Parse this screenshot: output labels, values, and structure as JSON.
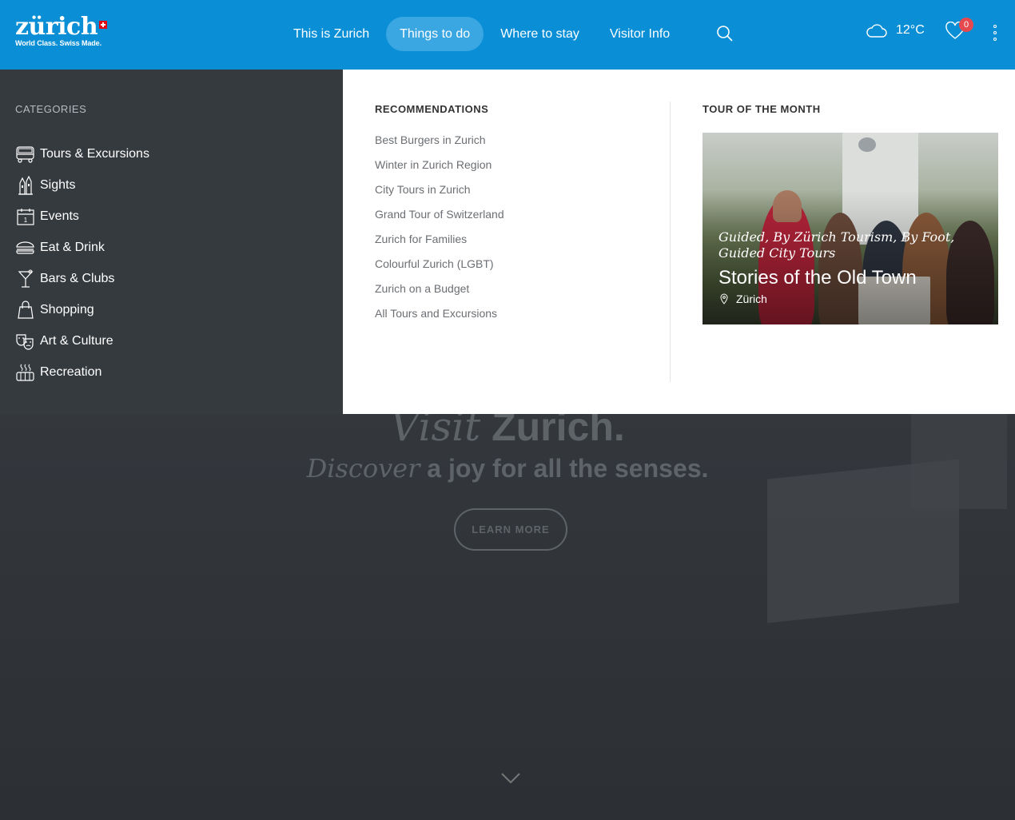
{
  "header": {
    "logo": {
      "wordmark": "zürich",
      "tagline": "World Class. Swiss Made."
    },
    "nav": [
      {
        "label": "This is Zurich",
        "active": false
      },
      {
        "label": "Things to do",
        "active": true
      },
      {
        "label": "Where to stay",
        "active": false
      },
      {
        "label": "Visitor Info",
        "active": false
      }
    ],
    "search_icon": "search-icon",
    "weather": {
      "icon": "cloud-icon",
      "temperature": "12°C"
    },
    "favorites": {
      "icon": "heart-icon",
      "count": "0"
    },
    "more_icon": "vertical-dots-icon",
    "brand_color": "#0a8fd6"
  },
  "categories": {
    "heading": "CATEGORIES",
    "items": [
      {
        "label": "Tours & Excursions",
        "icon": "bus-icon"
      },
      {
        "label": "Sights",
        "icon": "sights-icon"
      },
      {
        "label": "Events",
        "icon": "calendar-icon"
      },
      {
        "label": "Eat & Drink",
        "icon": "burger-icon"
      },
      {
        "label": "Bars & Clubs",
        "icon": "cocktail-icon"
      },
      {
        "label": "Shopping",
        "icon": "shopping-bag-icon"
      },
      {
        "label": "Art & Culture",
        "icon": "theater-masks-icon"
      },
      {
        "label": "Recreation",
        "icon": "hot-tub-icon"
      }
    ]
  },
  "recommendations": {
    "heading": "RECOMMENDATIONS",
    "items": [
      "Best Burgers in Zurich",
      "Winter in Zurich Region",
      "City Tours in Zurich",
      "Grand Tour of Switzerland",
      "Zurich for Families",
      "Colourful Zurich (LGBT)",
      "Zurich on a Budget",
      "All Tours and Excursions"
    ]
  },
  "tour_of_month": {
    "heading": "TOUR OF THE MONTH",
    "tags": "Guided, By Zürich Tourism, By Foot, Guided City Tours",
    "title": "Stories of the Old Town",
    "location": "Zürich"
  },
  "hero": {
    "title_italic": "Visit",
    "title_bold": "Zurich.",
    "subtitle_italic": "Discover",
    "subtitle_rest": "a joy for all the senses.",
    "button": "LEARN MORE"
  }
}
